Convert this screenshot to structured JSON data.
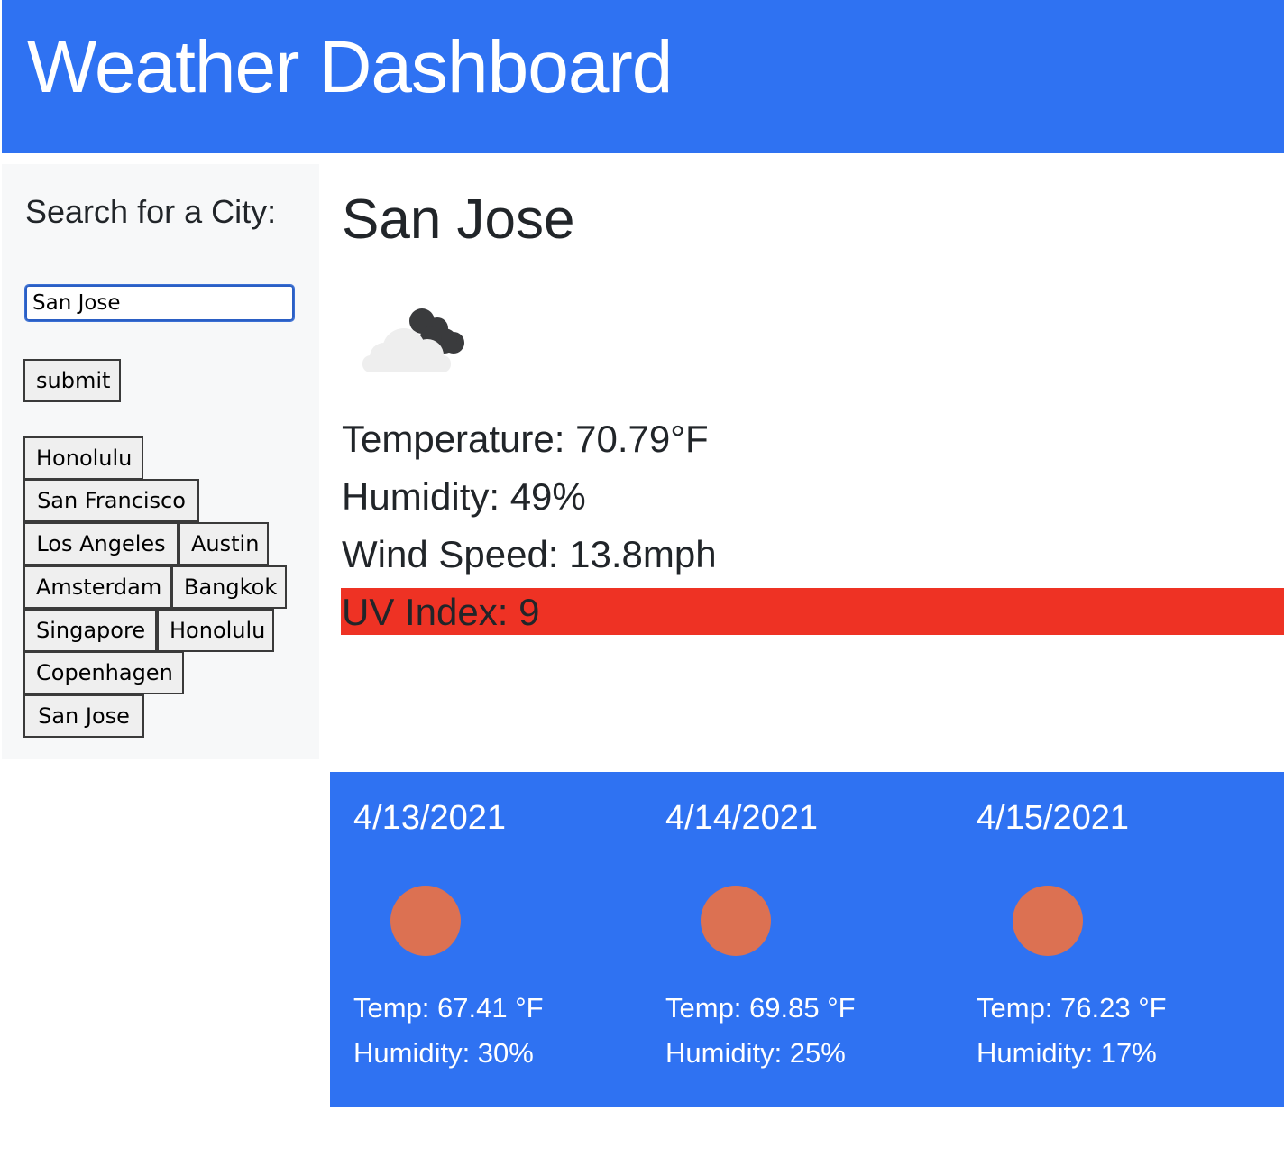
{
  "header": {
    "title": "Weather Dashboard"
  },
  "sidebar": {
    "search_heading": "Search for a City:",
    "search_value": "San Jose",
    "submit_label": "submit",
    "history": [
      "Honolulu",
      "San Francisco",
      "Los Angeles",
      "Austin",
      "Amsterdam",
      "Bangkok",
      "Singapore",
      "Honolulu",
      "Copenhagen",
      "San Jose"
    ]
  },
  "current": {
    "city": "San Jose",
    "icon": "partly-cloudy-icon",
    "temperature": "Temperature: 70.79°F",
    "humidity": "Humidity: 49%",
    "wind": "Wind Speed: 13.8mph",
    "uv": "UV Index: 9",
    "uv_color": "#ee3224"
  },
  "forecast": [
    {
      "date": "4/13/2021",
      "icon": "sun-icon",
      "temp": "Temp: 67.41 °F",
      "humidity": "Humidity: 30%"
    },
    {
      "date": "4/14/2021",
      "icon": "sun-icon",
      "temp": "Temp: 69.85 °F",
      "humidity": "Humidity: 25%"
    },
    {
      "date": "4/15/2021",
      "icon": "sun-icon",
      "temp": "Temp: 76.23 °F",
      "humidity": "Humidity: 17%"
    }
  ],
  "colors": {
    "brand": "#2f72f2",
    "sidebar_bg": "#f7f8f9",
    "sun": "#dc7152"
  }
}
